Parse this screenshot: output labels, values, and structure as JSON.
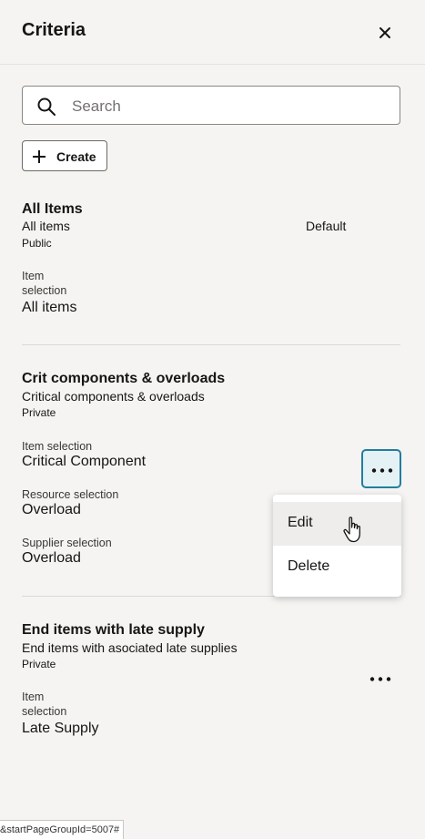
{
  "panel": {
    "title": "Criteria",
    "close_icon": "close-icon"
  },
  "search": {
    "placeholder": "Search",
    "value": ""
  },
  "create_button": {
    "label": "Create"
  },
  "criteria": [
    {
      "name": "All Items",
      "description": "All items",
      "visibility": "Public",
      "default_label": "Default",
      "fields": [
        {
          "label_line1": "Item",
          "label_line2": "selection",
          "value": "All items"
        }
      ]
    },
    {
      "name": "Crit components & overloads",
      "description": "Critical components & overloads",
      "visibility": "Private",
      "fields": [
        {
          "label": "Item selection",
          "value": "Critical Component"
        },
        {
          "label": "Resource selection",
          "value": "Overload"
        },
        {
          "label": "Supplier selection",
          "value": "Overload"
        }
      ]
    },
    {
      "name": "End items with late supply",
      "description": "End items with asociated late supplies",
      "visibility": "Private",
      "fields": [
        {
          "label_line1": "Item",
          "label_line2": "selection",
          "value": "Late Supply"
        }
      ]
    }
  ],
  "actions_menu": {
    "items": [
      {
        "label": "Edit"
      },
      {
        "label": "Delete"
      }
    ]
  },
  "status_bar": {
    "text": "&startPageGroupId=5007#"
  },
  "colors": {
    "accent": "#227e9e",
    "background": "#f5f4f2"
  }
}
